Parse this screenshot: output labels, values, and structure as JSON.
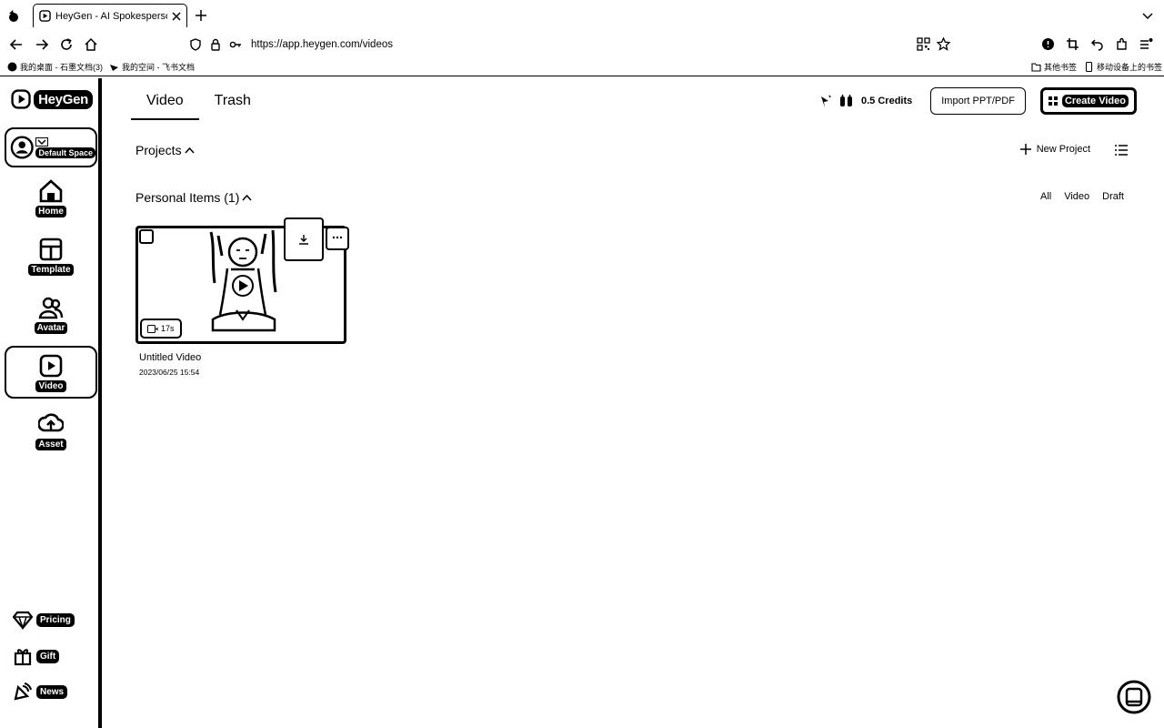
{
  "browser": {
    "tab_title": "HeyGen - AI Spokesperson Vid…",
    "url": "https://app.heygen.com/videos",
    "bookmarks": [
      "我的桌面 - 石墨文档(3)",
      "我的空间 - 飞书文档"
    ],
    "bookmarks_right": [
      "其他书签",
      "移动设备上的书签"
    ]
  },
  "sidebar": {
    "logo": "HeyGen",
    "space": "Default Space",
    "items": [
      {
        "label": "Home",
        "icon": "home-icon"
      },
      {
        "label": "Template",
        "icon": "template-icon"
      },
      {
        "label": "Avatar",
        "icon": "avatar-icon"
      },
      {
        "label": "Video",
        "icon": "video-icon",
        "active": true
      },
      {
        "label": "Asset",
        "icon": "upload-icon"
      }
    ],
    "bottom": [
      {
        "label": "Pricing",
        "icon": "diamond-icon"
      },
      {
        "label": "Gift",
        "icon": "gift-icon"
      },
      {
        "label": "News",
        "icon": "news-icon"
      }
    ]
  },
  "main": {
    "tabs": [
      "Video",
      "Trash"
    ],
    "credits": "0.5 Credits",
    "import_label": "Import PPT/PDF",
    "create_label": "Create Video",
    "projects_label": "Projects",
    "new_project_label": "New Project",
    "personal_label": "Personal Items (1)",
    "filters": [
      "All",
      "Video",
      "Draft"
    ],
    "video": {
      "title": "Untitled Video",
      "date": "2023/06/25 15:54",
      "duration": "17s"
    }
  }
}
